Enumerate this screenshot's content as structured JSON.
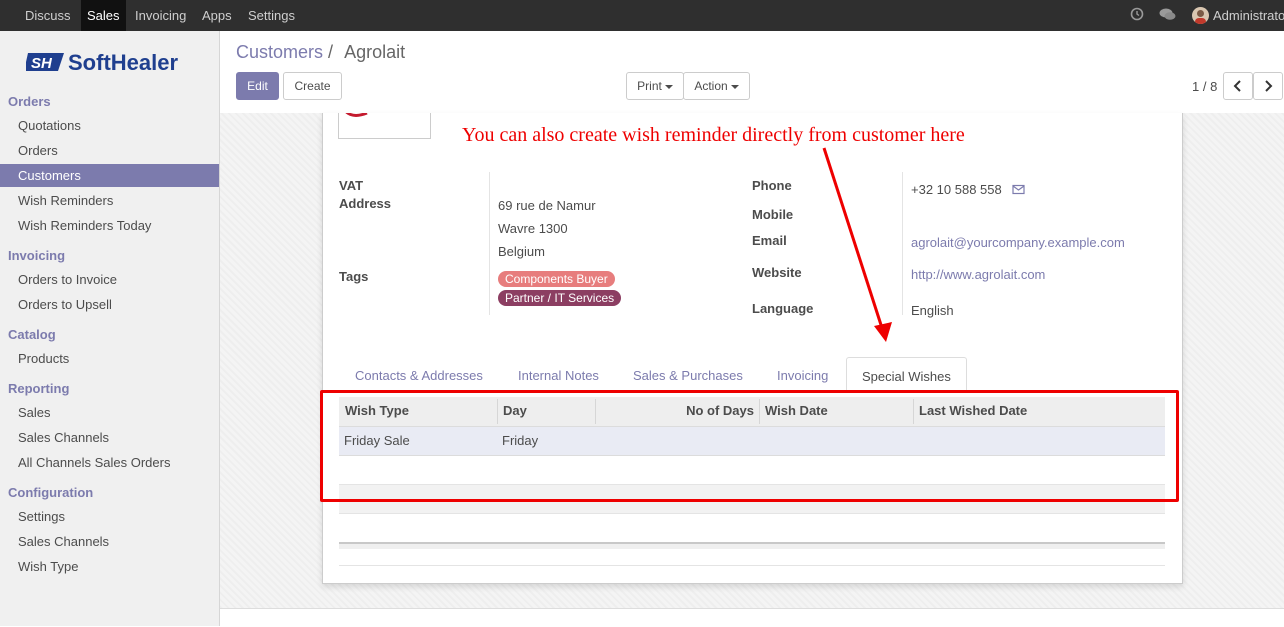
{
  "topbar": {
    "menu": [
      "Discuss",
      "Sales",
      "Invoicing",
      "Apps",
      "Settings"
    ],
    "active": "Sales",
    "user": "Administrato"
  },
  "brand": {
    "logo_text": "SoftHealer",
    "logo_mark": "SH"
  },
  "sidebar": {
    "sections": [
      {
        "title": "Orders",
        "items": [
          "Quotations",
          "Orders",
          "Customers",
          "Wish Reminders",
          "Wish Reminders Today"
        ]
      },
      {
        "title": "Invoicing",
        "items": [
          "Orders to Invoice",
          "Orders to Upsell"
        ]
      },
      {
        "title": "Catalog",
        "items": [
          "Products"
        ]
      },
      {
        "title": "Reporting",
        "items": [
          "Sales",
          "Sales Channels",
          "All Channels Sales Orders"
        ]
      },
      {
        "title": "Configuration",
        "items": [
          "Settings",
          "Sales Channels",
          "Wish Type"
        ]
      }
    ],
    "active_item": "Customers"
  },
  "breadcrumb": {
    "parent": "Customers",
    "separator": "/",
    "current": "Agrolait"
  },
  "buttons": {
    "edit": "Edit",
    "create": "Create",
    "print": "Print",
    "action": "Action"
  },
  "pager": {
    "text": "1 / 8"
  },
  "form": {
    "vat_label": "VAT",
    "address_label": "Address",
    "address_lines": [
      "69 rue de Namur",
      "Wavre 1300",
      "Belgium"
    ],
    "tags_label": "Tags",
    "tags": [
      {
        "name": "Components Buyer",
        "color": "#e77d7d"
      },
      {
        "name": "Partner / IT Services",
        "color": "#8c3e62"
      }
    ],
    "phone_label": "Phone",
    "phone": "+32 10 588 558",
    "mobile_label": "Mobile",
    "email_label": "Email",
    "email": "agrolait@yourcompany.example.com",
    "website_label": "Website",
    "website": "http://www.agrolait.com",
    "language_label": "Language",
    "language": "English"
  },
  "annotation": "You can also create wish reminder directly from customer here",
  "tabs": [
    "Contacts & Addresses",
    "Internal Notes",
    "Sales & Purchases",
    "Invoicing",
    "Special Wishes"
  ],
  "active_tab": "Special Wishes",
  "wish_table": {
    "columns": [
      "Wish Type",
      "Day",
      "No of Days",
      "Wish Date",
      "Last Wished Date"
    ],
    "rows": [
      [
        "Friday Sale",
        "Friday",
        "",
        "",
        ""
      ]
    ]
  },
  "colors": {
    "accent": "#7c7bad",
    "annotation": "#ee0000",
    "topbar": "#2f2f2f"
  }
}
